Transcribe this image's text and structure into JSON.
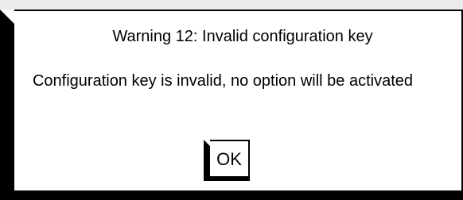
{
  "dialog": {
    "title": "Warning 12: Invalid configuration key",
    "message": "Configuration key is invalid, no option will be activated",
    "ok_label": "OK"
  },
  "colors": {
    "background": "#ffffff",
    "frame": "#000000",
    "top_strip": "#ebebeb"
  }
}
